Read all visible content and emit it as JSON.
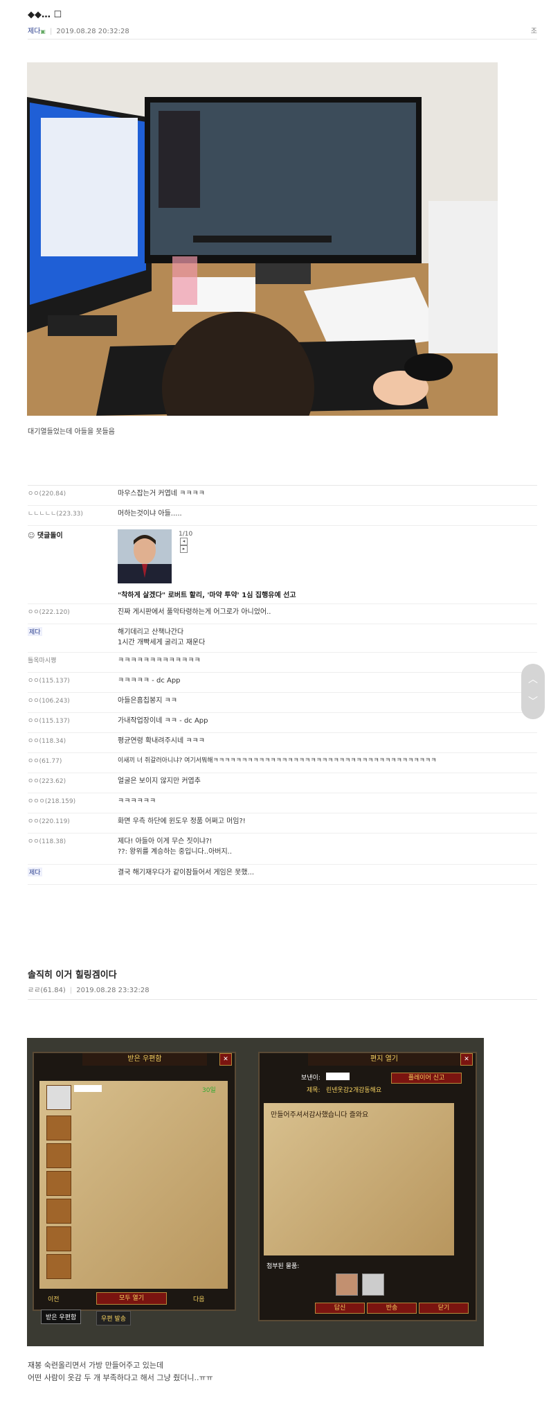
{
  "post1": {
    "title": "…",
    "author": "제다",
    "date": "2019.08.28 20:32:28",
    "right_label": "조",
    "caption": "대기열들었는데 아들을 못들음"
  },
  "comments": [
    {
      "author": "ㅇㅇ(220.84)",
      "text": "마우스잡는거 커엽네 ㅋㅋㅋㅋ"
    },
    {
      "author": "ㄴㄴㄴㄴㄴ(223.33)",
      "text": "머하는것이냐 아들....."
    },
    {
      "author": "댓글돌이",
      "pager": "1/10",
      "caption": "\"착하게 살겠다\" 로버트 할리, '마약 투약' 1심 집행유예 선고"
    },
    {
      "author": "ㅇㅇ(222.120)",
      "text": "진짜 게시판에서 풀악타령하는게 어그로가 아니었어.."
    },
    {
      "author": "제다",
      "text": "해기데리고 산책나간다",
      "text2": "1시간 개빡세게 굴리고 재운다"
    },
    {
      "author": "틀옥마시쪙",
      "text": "ㅋㅋㅋㅋㅋㅋㅋㅋㅋㅋㅋㅋㅋ"
    },
    {
      "author": "ㅇㅇ(115.137)",
      "text": "ㅋㅋㅋㅋㅋ - dc App"
    },
    {
      "author": "ㅇㅇ(106.243)",
      "text": "아들은흠칩봉지 ㅋㅋ"
    },
    {
      "author": "ㅇㅇ(115.137)",
      "text": "가내작업장이네 ㅋㅋ - dc App"
    },
    {
      "author": "ㅇㅇ(118.34)",
      "text": "평균연령 확내려주시네 ㅋㅋㅋ"
    },
    {
      "author": "ㅇㅇ(61.77)",
      "text": "이새끼 너 쥐갈러아니냐? 여기서뭐해ㅋㅋㅋㅋㅋㅋㅋㅋㅋㅋㅋㅋㅋㅋㅋㅋㅋㅋㅋㅋㅋㅋㅋㅋㅋㅋㅋㅋㅋㅋㅋㅋㅋㅋㅋㅋㅋㅋㅋ"
    },
    {
      "author": "ㅇㅇ(223.62)",
      "text": "얼굴은 보이지 않지만 커엽추"
    },
    {
      "author": "ㅇㅇㅇ(218.159)",
      "text": "ㅋㅋㅋㅋㅋㅋ"
    },
    {
      "author": "ㅇㅇ(220.119)",
      "text": "화면 우측 하단에 윈도우 정품 어쩌고 머임?!"
    },
    {
      "author": "ㅇㅇ(118.38)",
      "text": "제다! 아들아 이게 무슨 짓이냐?!",
      "text2": "??: 왕위를 계승하는 중입니다..아버지.."
    },
    {
      "author": "제다",
      "text": "결국 해기재우다가 같이잠들어서 게임은 못했..."
    }
  ],
  "post2": {
    "title": "솔직히 이거 힐링겜이다",
    "author": "ㄹㄹ(61.84)",
    "date": "2019.08.28 23:32:28",
    "caption1": "재봉 숙련올리면서 가방 만들어주고 있는데",
    "caption2": "어떤 사람이 옷감 두 개 부족하다고 해서 그냥 줬더니..ㅠㅠ"
  },
  "game": {
    "left_title": "받은 우편함",
    "right_title": "편지 열기",
    "sender_label": "보낸이:",
    "subject_label": "제목:",
    "subject": "린넨옷감2개감동해요",
    "report_btn": "플레이어 신고",
    "letter_text": "만들어주셔서감사했습니다 즐와요",
    "attach_label": "첨부된 물품:",
    "reply_btn": "답신",
    "return_btn": "반송",
    "close_btn": "닫기",
    "open_all_btn": "모두 열기",
    "prev_label": "이전",
    "next_label": "다음",
    "tab_inbox": "받은 우편함",
    "tab_send": "우편 발송",
    "item_count": "30일"
  }
}
